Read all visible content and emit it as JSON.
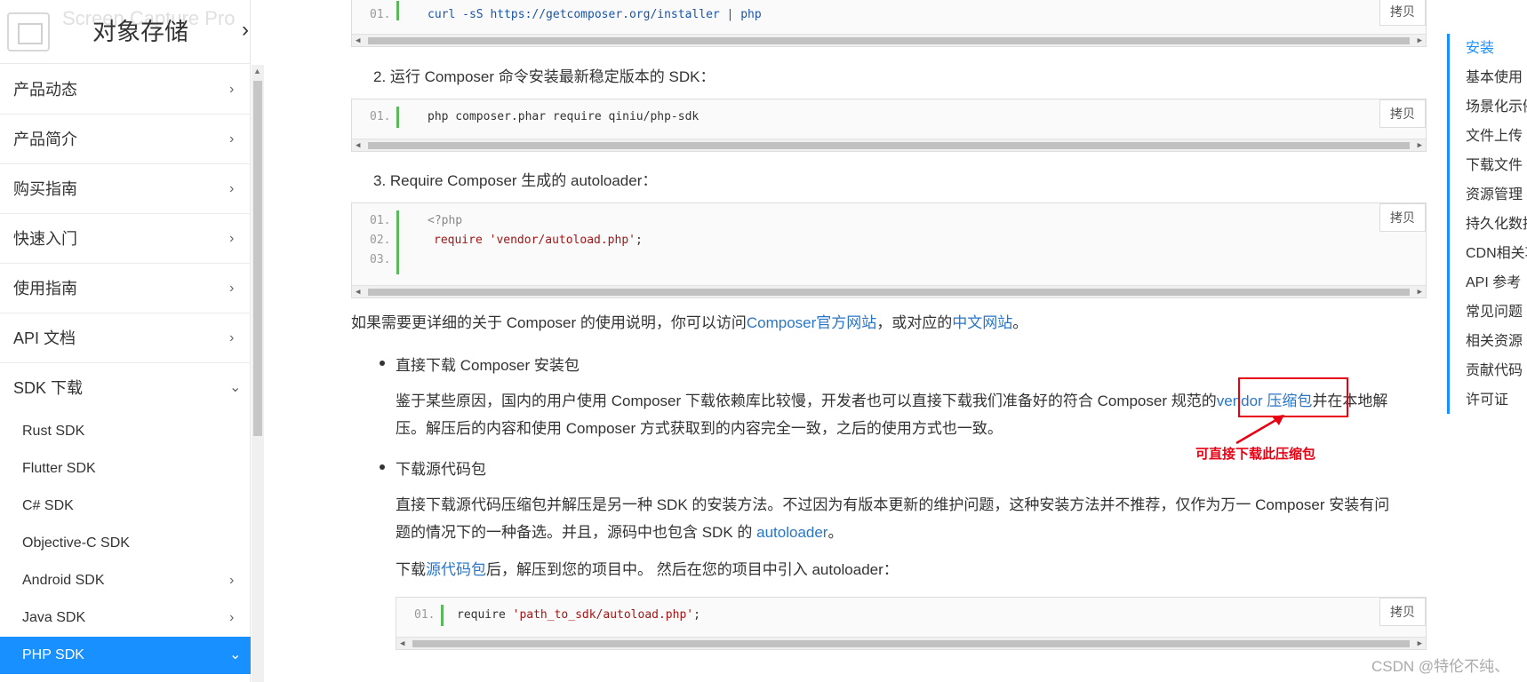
{
  "sidebar": {
    "title": "对象存储",
    "watermark": "Screen Capture Pro",
    "menu": [
      {
        "label": "产品动态"
      },
      {
        "label": "产品简介"
      },
      {
        "label": "购买指南"
      },
      {
        "label": "快速入门"
      },
      {
        "label": "使用指南"
      },
      {
        "label": "API 文档"
      },
      {
        "label": "SDK 下载"
      }
    ],
    "sdk_items": [
      {
        "label": "Rust SDK"
      },
      {
        "label": "Flutter SDK"
      },
      {
        "label": "C# SDK"
      },
      {
        "label": "Objective-C SDK"
      },
      {
        "label": "Android SDK"
      },
      {
        "label": "Java SDK"
      },
      {
        "label": "PHP SDK"
      }
    ]
  },
  "main": {
    "code1": {
      "ln": "01.",
      "code": "curl -sS https://getcomposer.org/installer | php",
      "copy": "拷贝"
    },
    "step2": "2. 运行 Composer 命令安装最新稳定版本的 SDK：",
    "code2": {
      "ln": "01.",
      "code": "php composer.phar require qiniu/php-sdk",
      "copy": "拷贝"
    },
    "step3": "3. Require Composer 生成的 autoloader：",
    "code3": {
      "lines": [
        {
          "ln": "01.",
          "code": "<?php"
        },
        {
          "ln": "02.",
          "code_kw": "require ",
          "code_str": "'vendor/autoload.php'",
          "code_end": ";"
        },
        {
          "ln": "03.",
          "code": ""
        }
      ],
      "copy": "拷贝"
    },
    "more_info": {
      "prefix": "如果需要更详细的关于 Composer 的使用说明，你可以访问",
      "link1": "Composer官方网站",
      "mid": "，或对应的",
      "link2": "中文网站",
      "suffix": "。"
    },
    "bullet1": "直接下载 Composer 安装包",
    "bullet1_para": {
      "prefix": "鉴于某些原因，国内的用户使用 Composer 下载依赖库比较慢，开发者也可以直接下载我们准备好的符合 Composer 规范的",
      "link": "vendor 压缩包",
      "suffix_line1": "并在本地解",
      "line2": "压。解压后的内容和使用 Composer 方式获取到的内容完全一致，之后的使用方式也一致。"
    },
    "annotation": "可直接下载此压缩包",
    "bullet2": "下载源代码包",
    "bullet2_para": {
      "line1": "直接下载源代码压缩包并解压是另一种 SDK 的安装方法。不过因为有版本更新的维护问题，这种安装方法并不推荐，仅作为万一 Composer 安装有问",
      "line2_prefix": "题的情况下的一种备选。并且，源码中也包含 SDK 的 ",
      "line2_link": "autoloader",
      "line2_suffix": "。"
    },
    "download_para": {
      "prefix": "下载",
      "link": "源代码包",
      "suffix": "后，解压到您的项目中。 然后在您的项目中引入 autoloader："
    },
    "code4": {
      "ln": "01.",
      "code_kw": "require ",
      "code_str": "'path_to_sdk/autoload.php'",
      "code_end": ";",
      "copy": "拷贝"
    }
  },
  "toc": {
    "items": [
      "安装",
      "基本使用",
      "场景化示例",
      "文件上传",
      "下载文件",
      "资源管理",
      "持久化数据处理",
      "CDN相关功能",
      "API 参考",
      "常见问题",
      "相关资源",
      "贡献代码",
      "许可证"
    ]
  },
  "csdn_mark": "CSDN @特伦不纯、",
  "colors": {
    "accent": "#1890ff",
    "link": "#2a76c6",
    "annotation": "#e60012"
  }
}
